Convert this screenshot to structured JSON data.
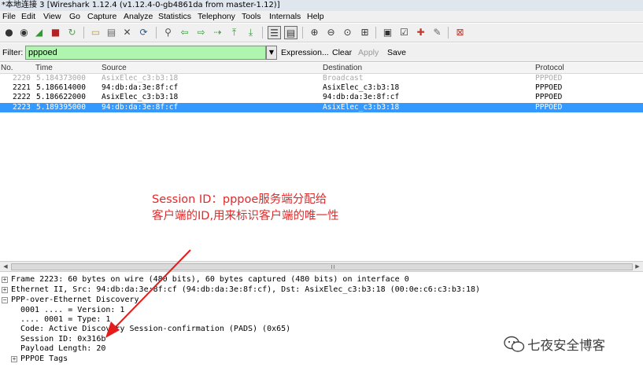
{
  "window": {
    "title": "*本地连接 3   [Wireshark 1.12.4  (v1.12.4-0-gb4861da from master-1.12)]"
  },
  "menu": [
    "File",
    "Edit",
    "View",
    "Go",
    "Capture",
    "Analyze",
    "Statistics",
    "Telephony",
    "Tools",
    "Internals",
    "Help"
  ],
  "toolbar": {
    "icons": [
      "interface-list-icon",
      "capture-options-icon",
      "start-capture-icon",
      "stop-capture-icon",
      "restart-capture-icon",
      "open-file-icon",
      "save-file-icon",
      "close-file-icon",
      "reload-icon",
      "find-packet-icon",
      "go-back-icon",
      "go-forward-icon",
      "go-to-packet-icon",
      "go-first-icon",
      "go-last-icon",
      "colorize-icon",
      "auto-scroll-icon",
      "zoom-in-icon",
      "zoom-out-icon",
      "zoom-normal-icon",
      "resize-columns-icon",
      "capture-filters-icon",
      "display-filters-icon",
      "coloring-rules-icon",
      "preferences-icon",
      "help-icon"
    ]
  },
  "filter": {
    "label": "Filter:",
    "value": "pppoed",
    "buttons": {
      "expression": "Expression...",
      "clear": "Clear",
      "apply": "Apply",
      "save": "Save"
    }
  },
  "packet_list": {
    "columns": [
      "No.",
      "Time",
      "Source",
      "Destination",
      "Protocol"
    ],
    "rows": [
      {
        "no": "2220",
        "time": "5.184373000",
        "source": "AsixElec_c3:b3:18",
        "destination": "Broadcast",
        "protocol": "PPPOED",
        "style": "dim"
      },
      {
        "no": "2221",
        "time": "5.186614000",
        "source": "94:db:da:3e:8f:cf",
        "destination": "AsixElec_c3:b3:18",
        "protocol": "PPPOED",
        "style": "normal"
      },
      {
        "no": "2222",
        "time": "5.186622000",
        "source": "AsixElec_c3:b3:18",
        "destination": "94:db:da:3e:8f:cf",
        "protocol": "PPPOED",
        "style": "normal"
      },
      {
        "no": "2223",
        "time": "5.189395000",
        "source": "94:db:da:3e:8f:cf",
        "destination": "AsixElec_c3:b3:18",
        "protocol": "PPPOED",
        "style": "selected"
      }
    ]
  },
  "annotation": {
    "line1": "Session ID：pppoe服务端分配给",
    "line2": "客户端的ID,用来标识客户端的唯一性",
    "color": "#e02a2a"
  },
  "details": {
    "frame": "Frame 2223: 60 bytes on wire (480 bits), 60 bytes captured (480 bits) on interface 0",
    "ethernet": "Ethernet II, Src: 94:db:da:3e:8f:cf (94:db:da:3e:8f:cf), Dst: AsixElec_c3:b3:18 (00:0e:c6:c3:b3:18)",
    "pppoe": "PPP-over-Ethernet Discovery",
    "version": "0001 .... = Version: 1",
    "type": ".... 0001 = Type: 1",
    "code": "Code: Active Discovery Session-confirmation (PADS) (0x65)",
    "session_id": "Session ID: 0x316b",
    "payload_length": "Payload Length: 20",
    "tags": "PPPOE Tags"
  },
  "watermark": {
    "text": "七夜安全博客",
    "icon": "wechat-icon"
  },
  "colors": {
    "selected_row": "#3399ff",
    "filter_valid": "#aff5af",
    "annotation": "#e02a2a"
  }
}
